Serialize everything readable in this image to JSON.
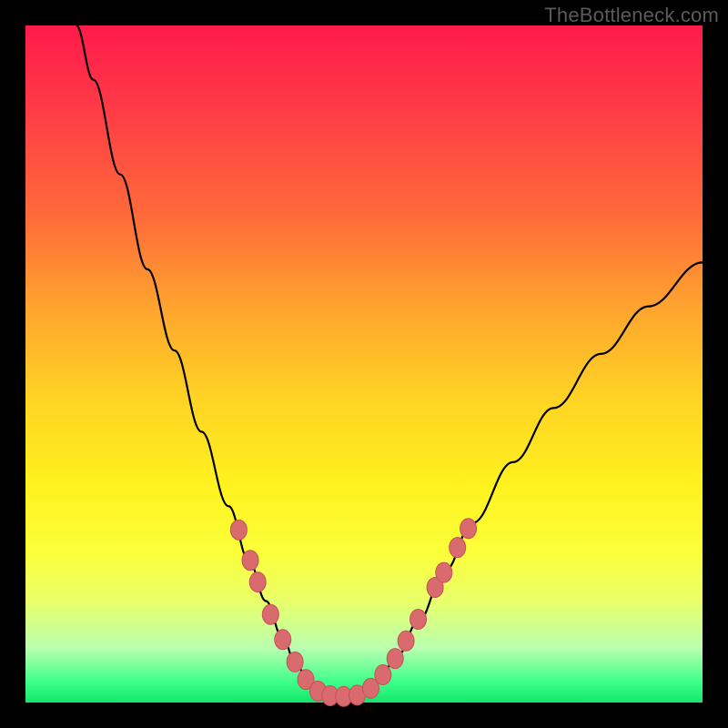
{
  "watermark": "TheBottleneck.com",
  "colors": {
    "marker_fill": "#d96a6e",
    "marker_stroke": "#c45258",
    "curve_stroke": "#000000"
  },
  "chart_data": {
    "type": "line",
    "title": "",
    "xlabel": "",
    "ylabel": "",
    "xlim": [
      0,
      100
    ],
    "ylim": [
      0,
      100
    ],
    "curve": [
      {
        "x": 7.5,
        "y": 100
      },
      {
        "x": 10,
        "y": 92
      },
      {
        "x": 14,
        "y": 78
      },
      {
        "x": 18,
        "y": 64
      },
      {
        "x": 22,
        "y": 52
      },
      {
        "x": 26,
        "y": 40
      },
      {
        "x": 30,
        "y": 29
      },
      {
        "x": 33,
        "y": 21
      },
      {
        "x": 35.5,
        "y": 15
      },
      {
        "x": 38,
        "y": 9.5
      },
      {
        "x": 40,
        "y": 5.5
      },
      {
        "x": 42,
        "y": 2.8
      },
      {
        "x": 44,
        "y": 1.4
      },
      {
        "x": 46,
        "y": 0.9
      },
      {
        "x": 48,
        "y": 0.9
      },
      {
        "x": 50,
        "y": 1.4
      },
      {
        "x": 52,
        "y": 3.0
      },
      {
        "x": 55,
        "y": 7.0
      },
      {
        "x": 58,
        "y": 12.0
      },
      {
        "x": 62,
        "y": 19.5
      },
      {
        "x": 66,
        "y": 26.5
      },
      {
        "x": 72,
        "y": 35.5
      },
      {
        "x": 78,
        "y": 43.5
      },
      {
        "x": 85,
        "y": 51.5
      },
      {
        "x": 92,
        "y": 58.5
      },
      {
        "x": 100,
        "y": 65
      }
    ],
    "markers": [
      {
        "x": 31.5,
        "y": 25.5
      },
      {
        "x": 33.2,
        "y": 21.0
      },
      {
        "x": 34.3,
        "y": 17.8
      },
      {
        "x": 36.2,
        "y": 13.0
      },
      {
        "x": 38.0,
        "y": 9.3
      },
      {
        "x": 39.8,
        "y": 6.0
      },
      {
        "x": 41.4,
        "y": 3.4
      },
      {
        "x": 43.2,
        "y": 1.7
      },
      {
        "x": 45.0,
        "y": 1.0
      },
      {
        "x": 47.0,
        "y": 0.9
      },
      {
        "x": 49.0,
        "y": 1.1
      },
      {
        "x": 51.0,
        "y": 2.1
      },
      {
        "x": 52.8,
        "y": 4.1
      },
      {
        "x": 54.6,
        "y": 6.5
      },
      {
        "x": 56.2,
        "y": 9.1
      },
      {
        "x": 58.0,
        "y": 12.3
      },
      {
        "x": 60.5,
        "y": 17.0
      },
      {
        "x": 61.8,
        "y": 19.2
      },
      {
        "x": 63.8,
        "y": 22.9
      },
      {
        "x": 65.4,
        "y": 25.7
      }
    ]
  }
}
